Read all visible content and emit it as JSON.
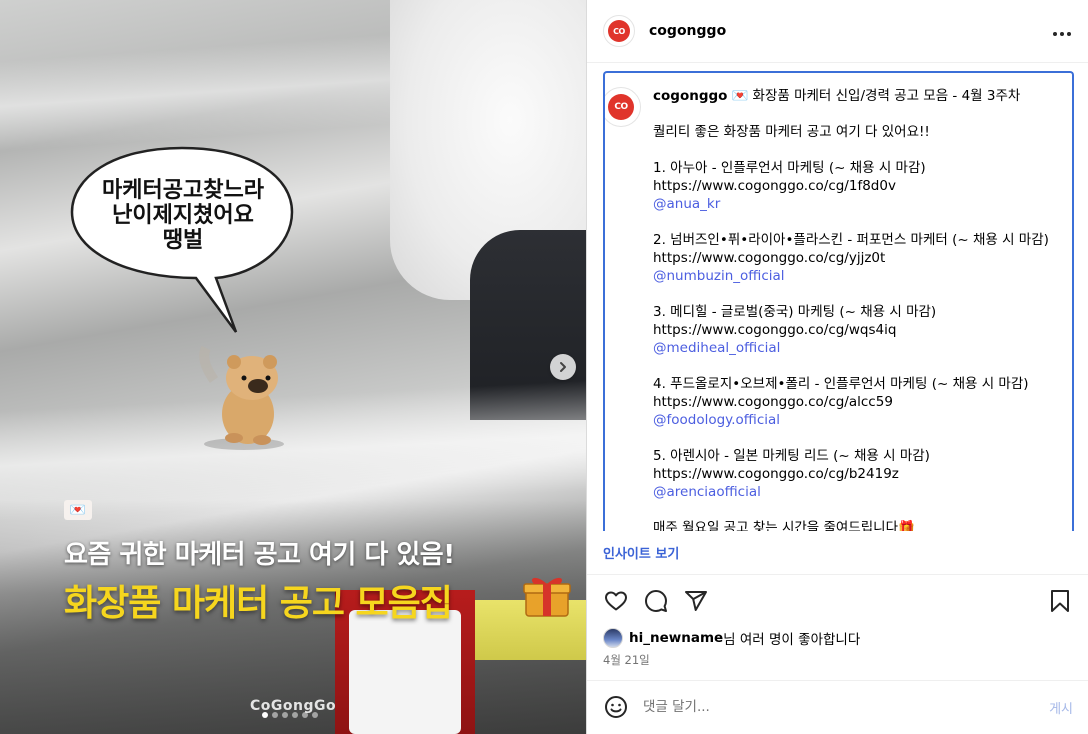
{
  "image": {
    "bubble_text": [
      "마케터공고찾느라",
      "난이제지쳤어요",
      "땡벌"
    ],
    "heart_emoji": "💌",
    "caption_line1": "요즘 귀한 마케터 공고 여기 다 있음!",
    "caption_line2": "화장품 마케터 공고 모음집",
    "watermark": "CoGongGo",
    "slide_count": 6,
    "active_slide": 1
  },
  "header": {
    "avatar_text": "CO",
    "username": "cogonggo",
    "more_icon": "more-icon"
  },
  "post": {
    "username": "cogonggo",
    "title": "💌 화장품 마케터 신입/경력 공고 모음 - 4월 3주차",
    "intro": "퀄리티 좋은 화장품 마케터 공고 여기 다 있어요!!",
    "jobs": [
      {
        "title": "1. 아누아 - 인플루언서 마케팅 (~ 채용 시 마감)",
        "url": "https://www.cogonggo.co/cg/1f8d0v",
        "handle": "@anua_kr"
      },
      {
        "title": "2. 넘버즈인•퓌•라이아•플라스킨 - 퍼포먼스 마케터 (~ 채용 시 마감)",
        "url": "https://www.cogonggo.co/cg/yjjz0t",
        "handle": "@numbuzin_official"
      },
      {
        "title": "3. 메디힐 - 글로벌(중국) 마케팅 (~ 채용 시 마감)",
        "url": "https://www.cogonggo.co/cg/wqs4iq",
        "handle": "@mediheal_official"
      },
      {
        "title": "4. 푸드올로지•오브제•폴리 - 인플루언서 마케팅 (~ 채용 시 마감)",
        "url": "https://www.cogonggo.co/cg/alcc59",
        "handle": "@foodology.official"
      },
      {
        "title": "5. 아렌시아 - 일본 마케팅 리드 (~ 채용 시 마감)",
        "url": "https://www.cogonggo.co/cg/b2419z",
        "handle": "@arenciaofficial"
      }
    ],
    "footer": "매주 월요일 공고 찾는 시간을 줄여드립니다🎁"
  },
  "insight_link": "인사이트 보기",
  "likes": {
    "user": "hi_newname",
    "suffix": "님 여러 명이 좋아합니다"
  },
  "date": "4월 21일",
  "comment": {
    "placeholder": "댓글 달기...",
    "post_label": "게시"
  },
  "colors": {
    "accent": "#3b6fd8",
    "link": "#4c5ee0",
    "brand_red": "#e0342b",
    "caption_yellow": "#f6d61e"
  }
}
